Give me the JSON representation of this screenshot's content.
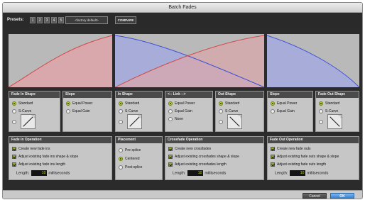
{
  "window": {
    "title": "Batch Fades"
  },
  "presets": {
    "label": "Presets:",
    "numbers": [
      "1",
      "2",
      "3",
      "4",
      "5"
    ],
    "factory_default": "<factory default>",
    "compare": "COMPARE"
  },
  "fade_in_shape": {
    "title": "Fade In Shape",
    "options": [
      "Standard",
      "S-Curve"
    ],
    "selected": "Standard"
  },
  "fade_in_slope": {
    "title": "Slope",
    "options": [
      "Equal Power",
      "Equal Gain"
    ],
    "selected": "Equal Power"
  },
  "in_shape": {
    "title": "In Shape",
    "options": [
      "Standard",
      "S-Curve"
    ],
    "selected": "Standard"
  },
  "link": {
    "title": "<-- Link -->",
    "options": [
      "Equal Power",
      "Equal Gain",
      "None"
    ],
    "selected": "Equal Power"
  },
  "out_shape": {
    "title": "Out Shape",
    "options": [
      "Standard",
      "S-Curve"
    ],
    "selected": "Standard"
  },
  "fade_out_slope": {
    "title": "Slope",
    "options": [
      "Equal Power",
      "Equal Gain"
    ],
    "selected": "Equal Power"
  },
  "fade_out_shape": {
    "title": "Fade Out Shape",
    "options": [
      "Standard",
      "S-Curve"
    ],
    "selected": "Standard"
  },
  "fade_in_operation": {
    "title": "Fade In Operation",
    "checks": [
      "Create new fade ins",
      "Adjust existing fade ins shape & slope",
      "Adjust existing fade ins length"
    ],
    "length_label": "Length:",
    "length_value": "10",
    "length_unit": "milliseconds"
  },
  "placement": {
    "title": "Placement",
    "options": [
      "Pre-splice",
      "Centered",
      "Post-splice"
    ],
    "selected": "Centered"
  },
  "crossfade_operation": {
    "title": "Crossfade Operation",
    "checks": [
      "Create new crossfades",
      "Adjust existing crossfades shape & slope",
      "Adjust existing crossfades length"
    ],
    "length_label": "Length:",
    "length_value": "10",
    "length_unit": "milliseconds"
  },
  "fade_out_operation": {
    "title": "Fade Out Operation",
    "checks": [
      "Create new fade outs",
      "Adjust existing fade outs shape & slope",
      "Adjust existing fade outs length"
    ],
    "length_label": "Length:",
    "length_value": "10",
    "length_unit": "milliseconds"
  },
  "footer": {
    "cancel": "Cancel",
    "ok": "OK"
  },
  "colors": {
    "fade_in_curve": "#d24a4a",
    "fade_out_curve": "#3b4fd6",
    "fade_in_fill": "#d9a8ac",
    "fade_out_fill": "#a7acd8",
    "accent_radio": "#b7d43a",
    "length_text": "#c9d92a",
    "ok_blue": "#3b86d8"
  }
}
